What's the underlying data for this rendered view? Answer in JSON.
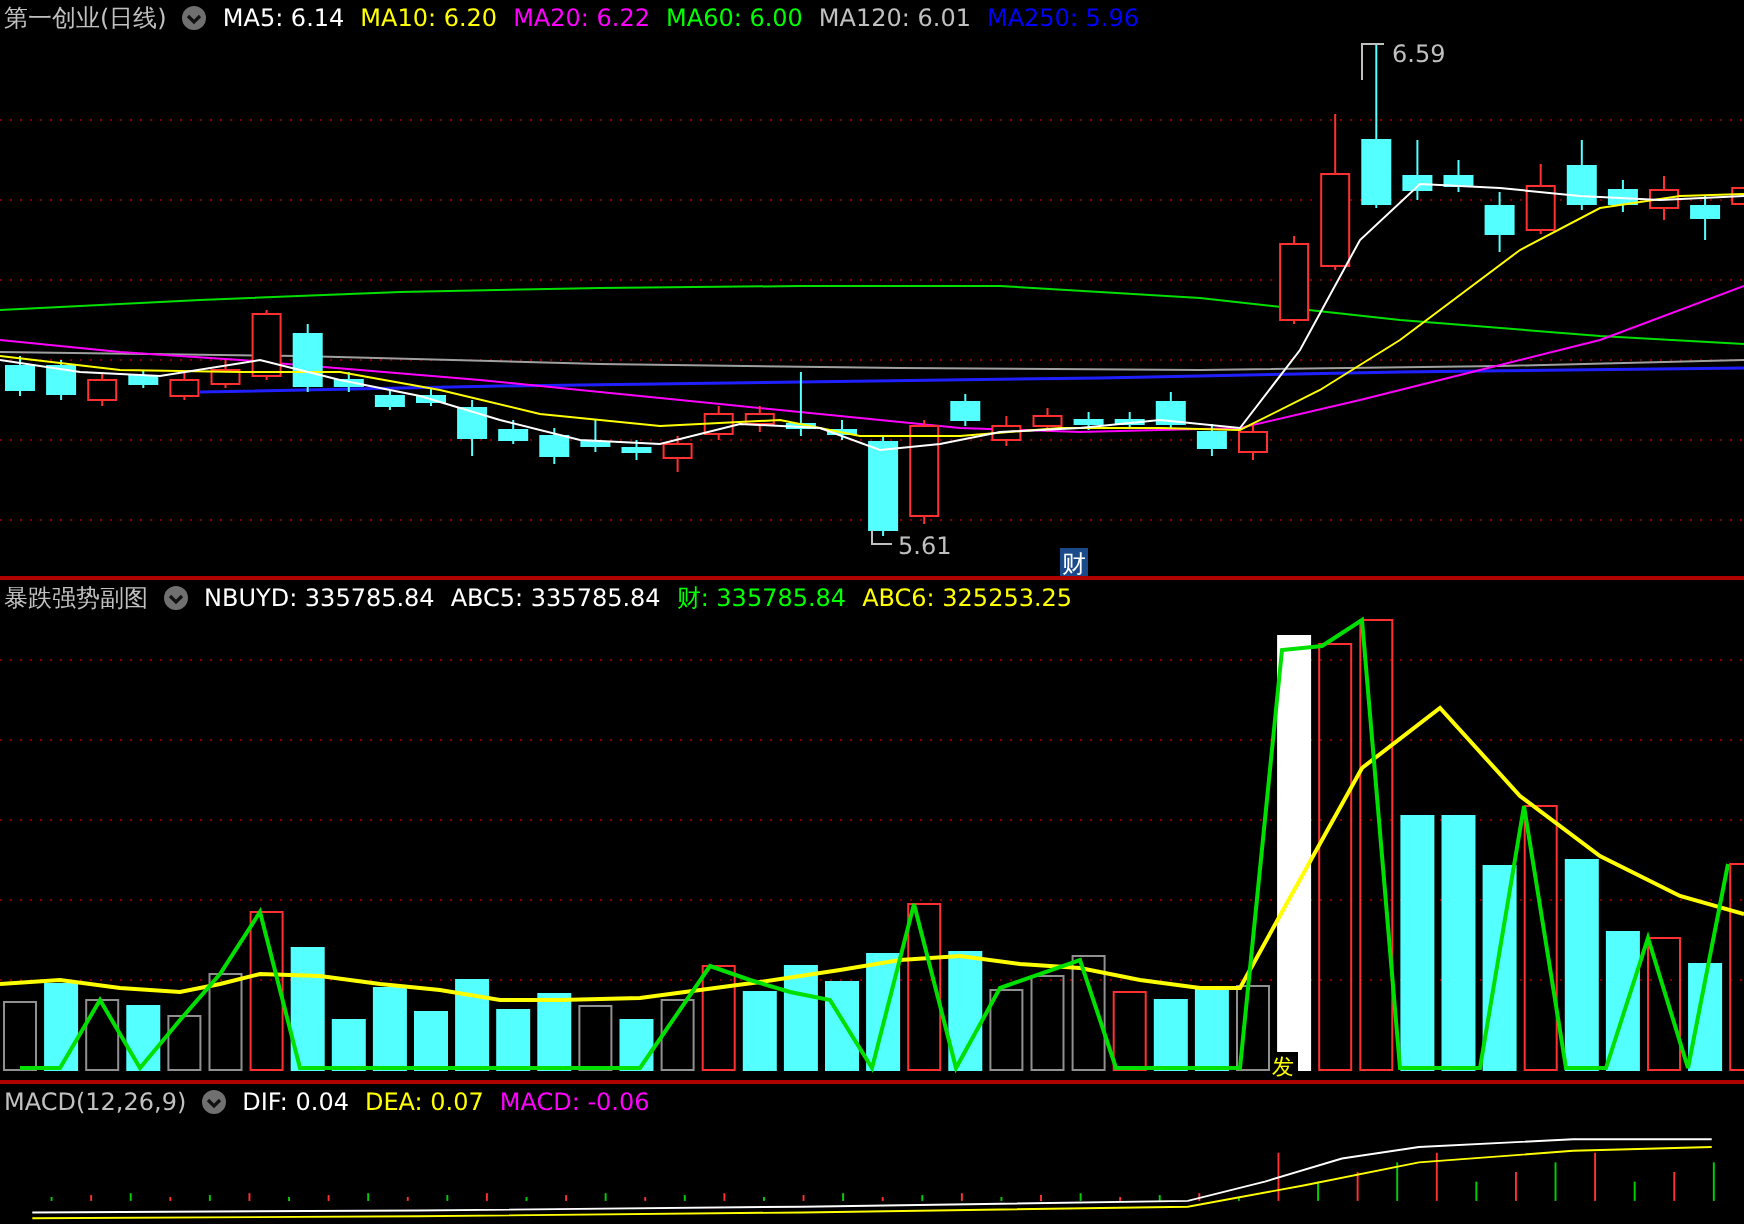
{
  "main_panel": {
    "title": "第一创业(日线)",
    "indicators": [
      {
        "label": "MA5: 6.14",
        "color": "#ffffff"
      },
      {
        "label": "MA10: 6.20",
        "color": "#ffff00"
      },
      {
        "label": "MA20: 6.22",
        "color": "#ff00ff"
      },
      {
        "label": "MA60: 6.00",
        "color": "#00ff00"
      },
      {
        "label": "MA120: 6.01",
        "color": "#c0c0c0"
      },
      {
        "label": "MA250: 5.96",
        "color": "#0000ff"
      }
    ],
    "high_label": "6.59",
    "low_label": "5.61",
    "event_marker": "财"
  },
  "sub_panel": {
    "title": "暴跌强势副图",
    "indicators": [
      {
        "label": "NBUYD: 335785.84",
        "color": "#ffffff"
      },
      {
        "label": "ABC5: 335785.84",
        "color": "#ffffff"
      },
      {
        "label": "财: 335785.84",
        "color": "#00ff00"
      },
      {
        "label": "ABC6: 325253.25",
        "color": "#ffff00"
      }
    ],
    "signal_label": "发"
  },
  "macd_panel": {
    "title": "MACD(12,26,9)",
    "indicators": [
      {
        "label": "DIF: 0.04",
        "color": "#ffffff"
      },
      {
        "label": "DEA: 0.07",
        "color": "#ffff00"
      },
      {
        "label": "MACD: -0.06",
        "color": "#ff00ff"
      }
    ]
  }
}
